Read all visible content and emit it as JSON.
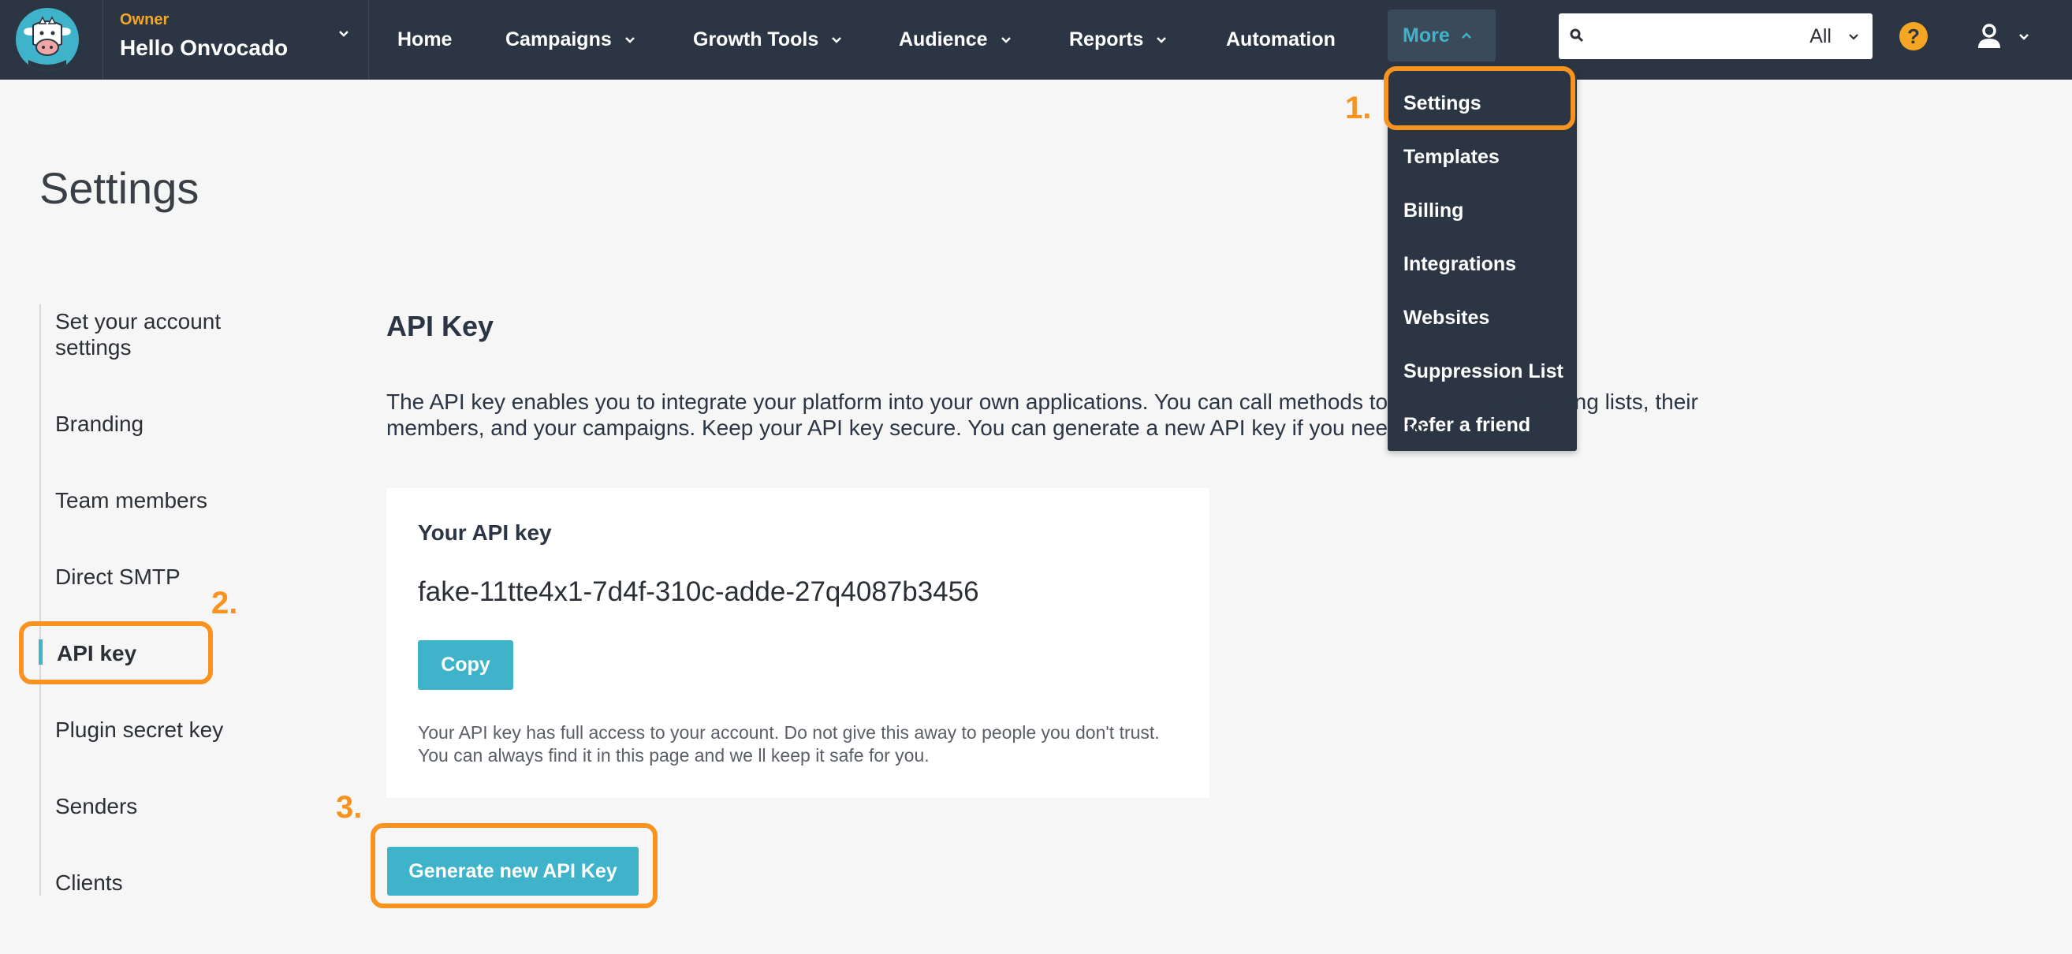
{
  "account": {
    "role": "Owner",
    "name": "Hello Onvocado"
  },
  "nav": {
    "items": [
      {
        "label": "Home"
      },
      {
        "label": "Campaigns"
      },
      {
        "label": "Growth Tools"
      },
      {
        "label": "Audience"
      },
      {
        "label": "Reports"
      },
      {
        "label": "Automation"
      }
    ],
    "more_label": "More"
  },
  "search": {
    "value": "",
    "scope": "All"
  },
  "help_symbol": "?",
  "dropdown": {
    "items": [
      "Settings",
      "Templates",
      "Billing",
      "Integrations",
      "Websites",
      "Suppression List",
      "Refer a friend"
    ]
  },
  "page": {
    "title": "Settings"
  },
  "sidebar": {
    "items": [
      {
        "label": "Set your account settings"
      },
      {
        "label": "Branding"
      },
      {
        "label": "Team members"
      },
      {
        "label": "Direct SMTP"
      },
      {
        "label": "API key"
      },
      {
        "label": "Plugin secret key"
      },
      {
        "label": "Senders"
      },
      {
        "label": "Clients"
      }
    ]
  },
  "section": {
    "title": "API Key",
    "description": "The API key enables you to integrate your platform into your own applications. You can call methods to manage your mailing lists, their members, and your campaigns. Keep your API key secure. You can generate a new API key if you need to."
  },
  "api_card": {
    "title": "Your API key",
    "value": "fake-11tte4x1-7d4f-310c-adde-27q4087b3456",
    "copy_label": "Copy",
    "note": "Your API key has full access to your account. Do not give this away to people you don't trust. You can always find it in this page and we ll keep it safe for you."
  },
  "generate_label": "Generate new API Key",
  "annotations": {
    "step1": "1.",
    "step2": "2.",
    "step3": "3."
  },
  "colors": {
    "nav_bg": "#2b3543",
    "accent": "#3fb3c9",
    "highlight": "#f7931e",
    "owner": "#f5a623"
  }
}
